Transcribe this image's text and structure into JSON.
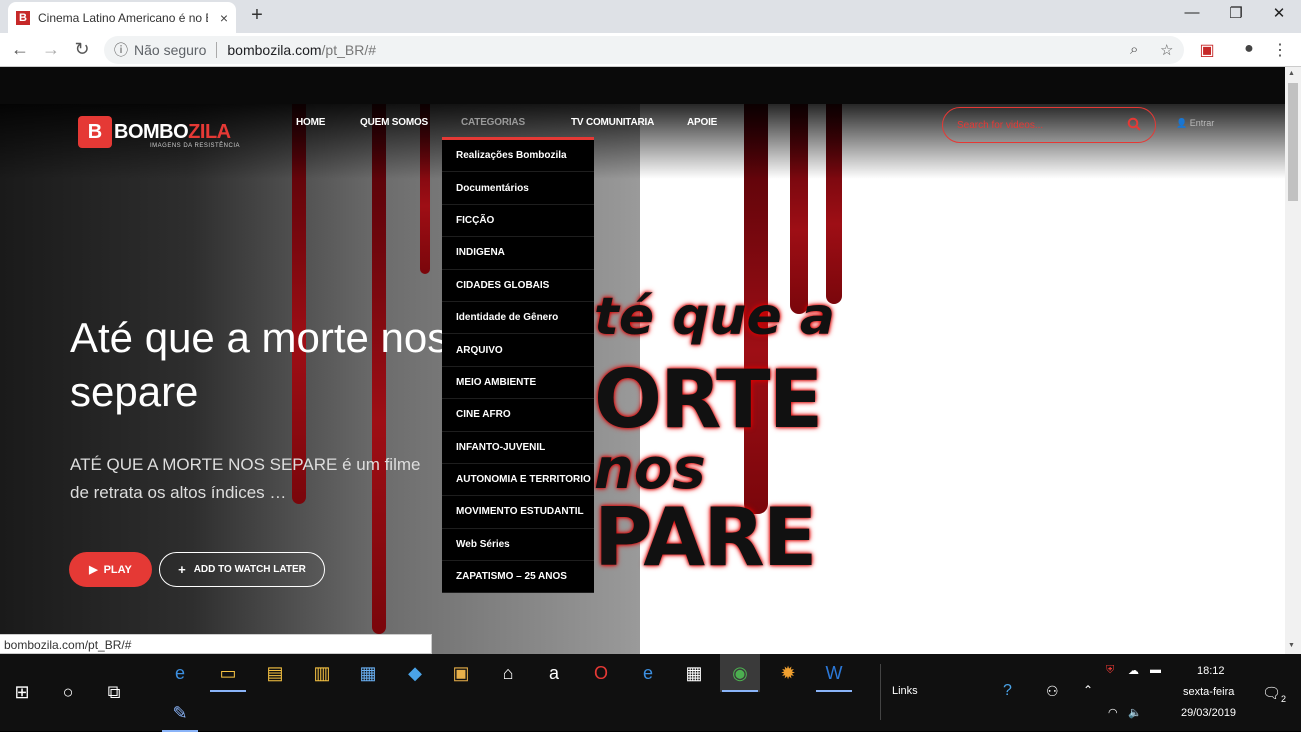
{
  "browser": {
    "tab_title": "Cinema Latino Americano é no B",
    "tab_favicon": "B",
    "tab_close": "×",
    "new_tab": "+",
    "window_controls": {
      "minimize": "—",
      "restore": "❐",
      "close": "✕"
    },
    "address": {
      "security_label": "Não seguro",
      "host": "bombozila.com",
      "path": "/pt_BR/#"
    },
    "status_url": "bombozila.com/pt_BR/#"
  },
  "site": {
    "logo_main": "BOMBO",
    "logo_red": "ZILA",
    "logo_tagline": "IMAGENS DA RESISTÊNCIA",
    "nav": {
      "home": "HOME",
      "quem_somos": "QUEM SOMOS",
      "categorias": "CATEGORIAS",
      "tv": "TV COMUNITARIA",
      "apoie": "APOIE"
    },
    "search_placeholder": "Search for videos...",
    "login_label": "Entrar",
    "categories": [
      "Realizações Bombozila",
      "Documentários",
      "FICÇÃO",
      "INDIGENA",
      "CIDADES GLOBAIS",
      "Identidade de Gênero",
      "ARQUIVO",
      "MEIO AMBIENTE",
      "CINE AFRO",
      "INFANTO-JUVENIL",
      "AUTONOMIA E TERRITORIO",
      "MOVIMENTO ESTUDANTIL",
      "Web Séries",
      "ZAPATISMO – 25 ANOS"
    ],
    "hero": {
      "title": "Até que a morte nos separe",
      "description": "ATÉ QUE A MORTE NOS SEPARE é um filme de retrata os altos índices …",
      "play_label": "PLAY",
      "watch_later_label": "ADD TO WATCH LATER"
    },
    "poster": {
      "line1": "té que a",
      "line2": "ORTE",
      "line3": "nos",
      "line4": "PARE"
    }
  },
  "taskbar": {
    "links_label": "Links",
    "time": "18:12",
    "day": "sexta-feira",
    "date": "29/03/2019",
    "notification_count": "2"
  },
  "colors": {
    "accent": "#e53935",
    "drip": "#9e0e15"
  }
}
